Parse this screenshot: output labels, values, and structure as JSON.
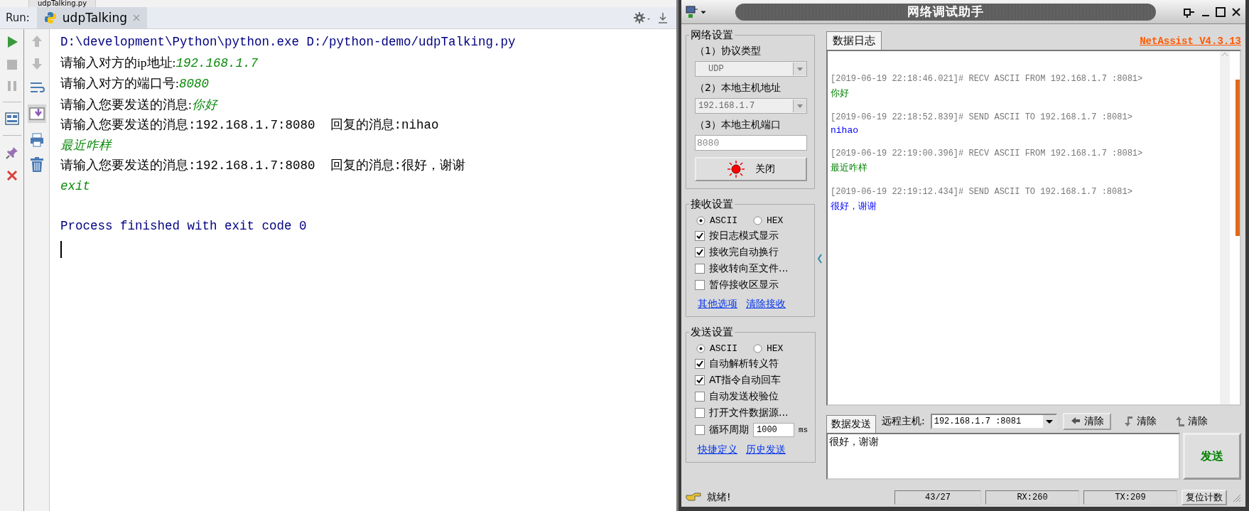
{
  "ide": {
    "editor_tab": "udpTalking.py",
    "run_label": "Run:",
    "run_tabs": [
      {
        "label": "udpTalking",
        "selected": true
      }
    ],
    "console": [
      {
        "kind": "command",
        "text": "D:\\development\\Python\\python.exe D:/python-demo/udpTalking.py"
      },
      {
        "kind": "prompt",
        "text": "请输入对方的ip地址:",
        "input": "192.168.1.7"
      },
      {
        "kind": "prompt",
        "text": "请输入对方的端口号:",
        "input": "8080"
      },
      {
        "kind": "prompt",
        "text": "请输入您要发送的消息:",
        "input": "你好"
      },
      {
        "kind": "output",
        "text": "请输入您要发送的消息:192.168.1.7:8080  回复的消息:nihao"
      },
      {
        "kind": "input",
        "text": "最近咋样"
      },
      {
        "kind": "output",
        "text": "请输入您要发送的消息:192.168.1.7:8080  回复的消息:很好，谢谢"
      },
      {
        "kind": "input",
        "text": "exit"
      },
      {
        "kind": "system",
        "text": "Process finished with exit code 0"
      }
    ]
  },
  "netassist": {
    "title": "网络调试助手",
    "network": {
      "title": "网络设置",
      "protocol_label": "（1）协议类型",
      "protocol": "UDP",
      "host_label": "（2）本地主机地址",
      "host": "192.168.1.7",
      "port_label": "（3）本地主机端口",
      "port": "8080",
      "toggle_button": "关闭"
    },
    "receive": {
      "title": "接收设置",
      "modes": [
        {
          "label": "ASCII",
          "selected": true
        },
        {
          "label": "HEX",
          "selected": false
        }
      ],
      "options": [
        {
          "label": "按日志模式显示",
          "checked": true
        },
        {
          "label": "接收完自动换行",
          "checked": true
        },
        {
          "label": "接收转向至文件...",
          "checked": false
        },
        {
          "label": "暂停接收区显示",
          "checked": false
        }
      ],
      "links": [
        "其他选项",
        "清除接收"
      ]
    },
    "send": {
      "title": "发送设置",
      "modes": [
        {
          "label": "ASCII",
          "selected": true
        },
        {
          "label": "HEX",
          "selected": false
        }
      ],
      "options": [
        {
          "label": "自动解析转义符",
          "checked": true
        },
        {
          "label": "AT指令自动回车",
          "checked": true
        },
        {
          "label": "自动发送校验位",
          "checked": false
        },
        {
          "label": "打开文件数据源...",
          "checked": false
        },
        {
          "label": "循环周期",
          "checked": false,
          "value": "1000",
          "unit": "ms"
        }
      ],
      "links": [
        "快捷定义",
        "历史发送"
      ]
    },
    "log": {
      "tabs": [
        {
          "label": "数据日志",
          "selected": true
        }
      ],
      "version": "NetAssist V4.3.13",
      "entries": [
        {
          "kind": "recv",
          "header": "[2019-06-19 22:18:46.021]# RECV ASCII FROM 192.168.1.7 :8081>",
          "message": "你好"
        },
        {
          "kind": "send",
          "header": "[2019-06-19 22:18:52.839]# SEND ASCII TO 192.168.1.7 :8081>",
          "message": "nihao"
        },
        {
          "kind": "recv",
          "header": "[2019-06-19 22:19:00.396]# RECV ASCII FROM 192.168.1.7 :8081>",
          "message": "最近咋样"
        },
        {
          "kind": "send",
          "header": "[2019-06-19 22:19:12.434]# SEND ASCII TO 192.168.1.7 :8081>",
          "message": "很好，谢谢"
        }
      ]
    },
    "send_panel": {
      "tabs": [
        {
          "label": "数据发送",
          "selected": true
        }
      ],
      "remote_label": "远程主机:",
      "remote": "192.168.1.7 :8081",
      "clear_buttons": [
        {
          "kind": "left",
          "label": "清除"
        },
        {
          "kind": "down",
          "label": "清除"
        },
        {
          "kind": "up",
          "label": "清除"
        }
      ],
      "message": "很好，谢谢",
      "send_button": "发送"
    },
    "status_bar": {
      "text": "就绪!",
      "counter": "43/27",
      "rx": "RX:260",
      "tx": "TX:209",
      "reset_button": "复位计数"
    }
  }
}
